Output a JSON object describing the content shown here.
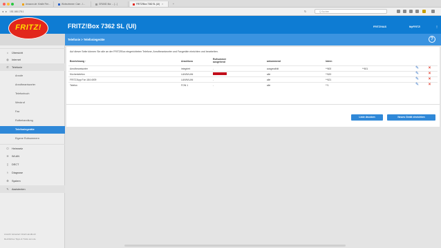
{
  "browser": {
    "tabs": [
      {
        "label": "Amazon.de: Kindle Fire..."
      },
      {
        "label": "Wohnzimmer: Cam - I..."
      },
      {
        "label": "GRUND Ma: ... [...]"
      },
      {
        "label": "FRITZ!Box 7362 SL (UI)"
      }
    ],
    "url": "192.168.178.1",
    "search_placeholder": "Q Suchen",
    "colors": {
      "close": "#fe5f57",
      "minimize": "#febc2e",
      "zoom": "#28c840"
    }
  },
  "header": {
    "logo_text": "FRITZ!",
    "product_title": "FRITZ!Box 7362 SL (UI)",
    "links": [
      "FRITZ!NAS",
      "MyFRITZ!"
    ],
    "more": "⋮",
    "colors": {
      "header_bg": "#0e7cd3",
      "logo_red": "#e2261c",
      "logo_yellow": "#ffde00"
    }
  },
  "subheader": {
    "breadcrumb": "Telefonie > Telefoniegeräte",
    "help": "?"
  },
  "sidebar": {
    "items": [
      {
        "label": "Übersicht",
        "icon": "home-icon",
        "level": "top"
      },
      {
        "label": "Internet",
        "icon": "globe-icon",
        "level": "top"
      },
      {
        "label": "Telefonie",
        "icon": "phone-icon",
        "level": "top",
        "expanded": true
      },
      {
        "label": "Anrufe",
        "level": "sub"
      },
      {
        "label": "Anrufbeantworter",
        "level": "sub"
      },
      {
        "label": "Telefonbuch",
        "level": "sub"
      },
      {
        "label": "Weckruf",
        "level": "sub"
      },
      {
        "label": "Fax",
        "level": "sub"
      },
      {
        "label": "Rufbehandlung",
        "level": "sub"
      },
      {
        "label": "Telefoniegeräte",
        "level": "sub",
        "active": true
      },
      {
        "label": "Eigene Rufnummern",
        "level": "sub"
      },
      {
        "label": "Heimnetz",
        "icon": "network-icon",
        "level": "top"
      },
      {
        "label": "WLAN",
        "icon": "wifi-icon",
        "level": "top"
      },
      {
        "label": "DECT",
        "icon": "dect-icon",
        "level": "top"
      },
      {
        "label": "Diagnose",
        "icon": "diagnose-icon",
        "level": "top"
      },
      {
        "label": "System",
        "icon": "system-icon",
        "level": "top"
      },
      {
        "label": "Assistenten",
        "icon": "wand-icon",
        "level": "top"
      }
    ],
    "footer": [
      "Ansicht: Erweitert   Inhalt   Handbuch",
      "Rechtliches   Tipps & Tricks   avm.de"
    ]
  },
  "main": {
    "intro": "Auf dieser Seite können Sie alle an der FRITZ!Box eingerichteten Telefone, Anrufbeantworter und Faxgeräte einrichten und bearbeiten.",
    "columns": [
      "Bezeichnung ↑",
      "Anschluss",
      "Rufnummer ausgehend",
      "ankommend",
      "Intern"
    ],
    "rows": [
      {
        "name": "Anrufbeantworter",
        "port": "integriert",
        "outgoing": "-",
        "incoming": "ausgewählt",
        "internal": "**600",
        "extra": "**601"
      },
      {
        "name": "Küchentelefon",
        "port": "LAN/WLAN",
        "outgoing": "[red]",
        "incoming": "alle",
        "internal": "**620",
        "extra": ""
      },
      {
        "name": "FRITZ!App Fon 184:4009",
        "port": "LAN/WLAN",
        "outgoing": "-",
        "incoming": "alle",
        "internal": "**621",
        "extra": ""
      },
      {
        "name": "Telefon",
        "port": "FON 1",
        "outgoing": "-",
        "incoming": "alle",
        "internal": "**1",
        "extra": ""
      }
    ],
    "buttons": {
      "print": "Liste drucken",
      "new_device": "Neues Gerät einrichten"
    }
  }
}
